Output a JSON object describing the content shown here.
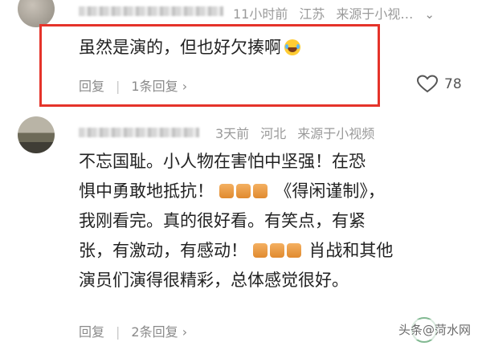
{
  "comment1": {
    "time": "11小时前",
    "location": "江苏",
    "source": "来源于小视…",
    "text": "虽然是演的，但也好欠揍啊",
    "reply_label": "回复",
    "replies_label": "1条回复",
    "likes": "78",
    "emoji": "laugh-cry-emoji"
  },
  "comment2": {
    "time": "3天前",
    "location": "河北",
    "source": "来源于小视频",
    "line1": "不忘国耻。小人物在害怕中坚强！在恐",
    "line2_a": "惧中勇敢地抵抗！",
    "line2_b": "《得闲谨制》，",
    "line3": "我刚看完。真的很好看。有笑点，有紧",
    "line4_a": "张，有激动，有感动！",
    "line4_b": "肖战和其他",
    "line5": "演员们演得很精彩，总体感觉很好。",
    "reply_label": "回复",
    "replies_label": "2条回复"
  },
  "watermark": {
    "text": "头条@菏水网"
  },
  "colors": {
    "highlight_border": "#e5332a",
    "meta_text": "#9a9a9a",
    "body_text": "#222222"
  }
}
